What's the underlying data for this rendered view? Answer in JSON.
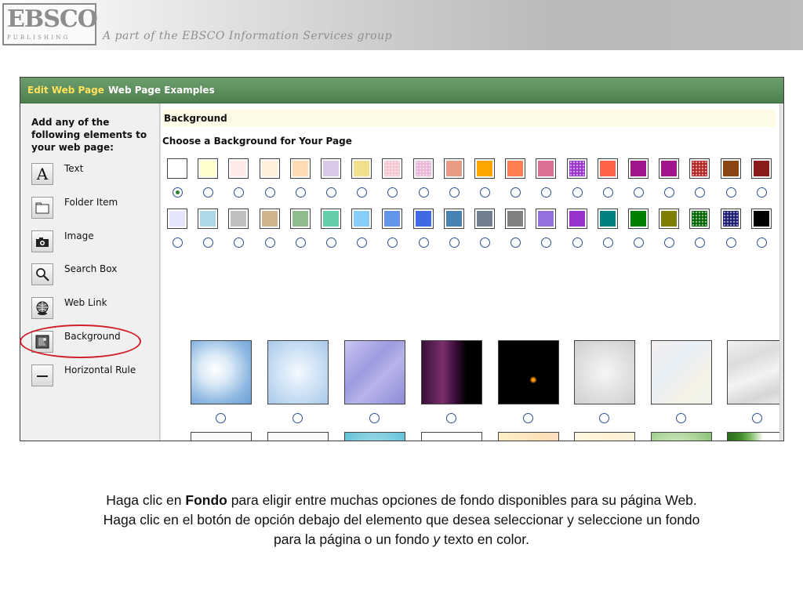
{
  "header": {
    "logo_text": "EBSCO",
    "logo_sub": "PUBLISHING",
    "tagline": "A part of the EBSCO Information Services group"
  },
  "tabs": [
    {
      "label": "Edit Web Page",
      "active": true
    },
    {
      "label": "Web Page Examples",
      "active": false
    }
  ],
  "sidebar": {
    "heading": "Add any of the following elements to your web page:",
    "items": [
      {
        "label": "Text",
        "icon": "text-icon"
      },
      {
        "label": "Folder Item",
        "icon": "folder-icon"
      },
      {
        "label": "Image",
        "icon": "camera-icon"
      },
      {
        "label": "Search Box",
        "icon": "magnifier-icon"
      },
      {
        "label": "Web Link",
        "icon": "globe-link-icon"
      },
      {
        "label": "Background",
        "icon": "background-icon"
      },
      {
        "label": "Horizontal Rule",
        "icon": "horizontal-rule-icon"
      }
    ]
  },
  "main": {
    "section_title": "Background",
    "choose_label": "Choose a Background for Your Page",
    "swatch_rows": [
      {
        "colors": [
          "#ffffff",
          "#ffffcc",
          "#ffeaea",
          "#fff0dc",
          "#ffdcb4",
          "#d9c9e6",
          "#f0e08c",
          "#f5c4cf",
          "#e8b4d8",
          "#e89a82",
          "#ffa500",
          "#ff7f50",
          "#db7093",
          "#9932cc",
          "#ff6347",
          "#a0148c",
          "#a0148c",
          "#b22222",
          "#8b4513",
          "#8b1a1a"
        ],
        "patterned": [
          false,
          false,
          false,
          false,
          false,
          false,
          false,
          true,
          true,
          false,
          false,
          false,
          false,
          true,
          false,
          false,
          false,
          true,
          false,
          false
        ],
        "selected_index": 0
      },
      {
        "colors": [
          "#e6e6fa",
          "#add8e6",
          "#c0c0c0",
          "#d2b48c",
          "#8fbc8f",
          "#66cdaa",
          "#87cefa",
          "#6495ed",
          "#4169e1",
          "#4682b4",
          "#708090",
          "#808080",
          "#9370db",
          "#9932cc",
          "#008080",
          "#008000",
          "#808000",
          "#006400",
          "#191970",
          "#000000"
        ],
        "patterned": [
          false,
          false,
          false,
          false,
          false,
          false,
          false,
          false,
          false,
          false,
          false,
          false,
          false,
          false,
          false,
          false,
          false,
          true,
          true,
          false
        ],
        "selected_index": -1
      }
    ],
    "image_rows": [
      [
        "sky-clouds",
        "light-clouds",
        "lightning-purple",
        "galaxy-purple",
        "starfield-black",
        "world-map-emboss",
        "flags-faded",
        "crumpled-paper"
      ],
      [
        "giraffes-faded",
        "butterflies-faded",
        "fish-underwater",
        "music-clefs",
        "music-sheet",
        "green-plant",
        "green-leaves",
        "ivy-edge"
      ]
    ]
  },
  "caption": {
    "line1_pre": "Haga clic en ",
    "line1_bold": "Fondo",
    "line1_post": " para eligir entre muchas opciones de fondo disponibles para su página Web.",
    "line2": "Haga clic en el botón de opción debajo del elemento que desea seleccionar y seleccione un fondo",
    "line3_pre": "para la página o un fondo ",
    "line3_italic": "y",
    "line3_post": " texto en color."
  }
}
